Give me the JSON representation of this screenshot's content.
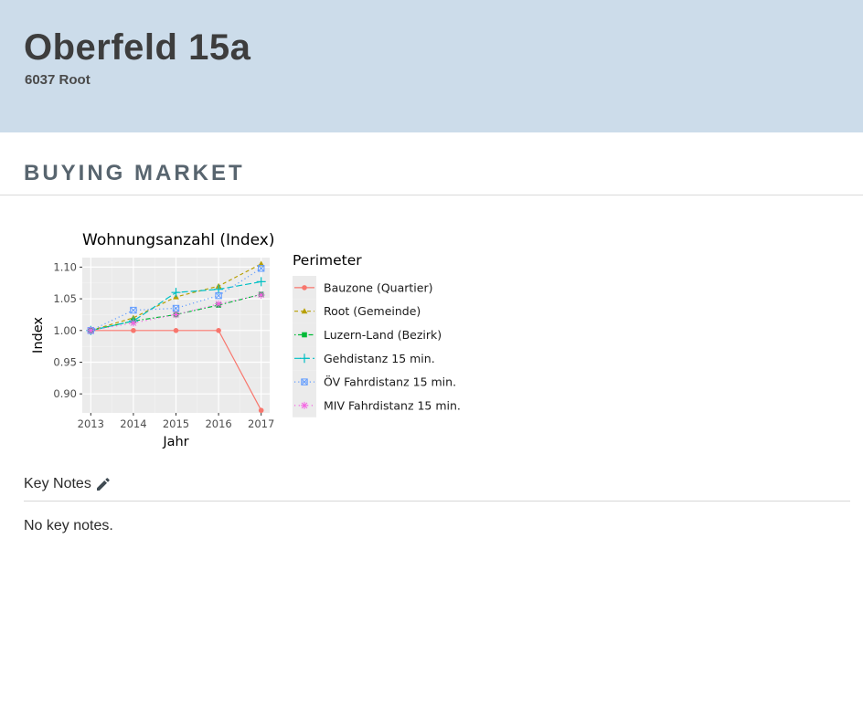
{
  "header": {
    "title": "Oberfeld 15a",
    "subtitle": "6037 Root"
  },
  "section": {
    "title": "BUYING MARKET"
  },
  "key_notes": {
    "label": "Key Notes",
    "edit_icon": "pencil-icon",
    "empty_text": "No key notes."
  },
  "colors": {
    "header_bg": "#ccdcea",
    "section_title": "#58656f"
  },
  "chart_data": {
    "type": "line",
    "title": "Wohnungsanzahl (Index)",
    "xlabel": "Jahr",
    "ylabel": "Index",
    "x": [
      2013,
      2014,
      2015,
      2016,
      2017
    ],
    "ylim": [
      0.87,
      1.115
    ],
    "yticks": [
      "0.90",
      "0.95",
      "1.00",
      "1.05",
      "1.10"
    ],
    "grid": true,
    "legend": {
      "title": "Perimeter",
      "placement": "right"
    },
    "series": [
      {
        "name": "Bauzone (Quartier)",
        "color": "#f8766d",
        "dash": "solid",
        "marker": "circle",
        "values": [
          1.0,
          1.0,
          1.0,
          1.0,
          0.874
        ]
      },
      {
        "name": "Root (Gemeinde)",
        "color": "#b79f00",
        "dash": "dashed",
        "marker": "triangle",
        "values": [
          1.0,
          1.02,
          1.053,
          1.07,
          1.105
        ]
      },
      {
        "name": "Luzern-Land (Bezirk)",
        "color": "#00ba38",
        "dash": "dotdash",
        "marker": "square",
        "values": [
          1.0,
          1.015,
          1.025,
          1.04,
          1.057
        ]
      },
      {
        "name": "Gehdistanz 15 min.",
        "color": "#00bfc4",
        "dash": "longdash",
        "marker": "plus",
        "values": [
          1.0,
          1.015,
          1.06,
          1.065,
          1.077
        ]
      },
      {
        "name": "ÖV Fahrdistanz 15 min.",
        "color": "#619cff",
        "dash": "dotted",
        "marker": "boxx",
        "values": [
          1.0,
          1.032,
          1.035,
          1.055,
          1.098
        ]
      },
      {
        "name": "MIV Fahrdistanz 15 min.",
        "color": "#f564e3",
        "dash": "dotted2",
        "marker": "asterisk",
        "values": [
          1.0,
          1.012,
          1.025,
          1.042,
          1.056
        ]
      }
    ]
  }
}
